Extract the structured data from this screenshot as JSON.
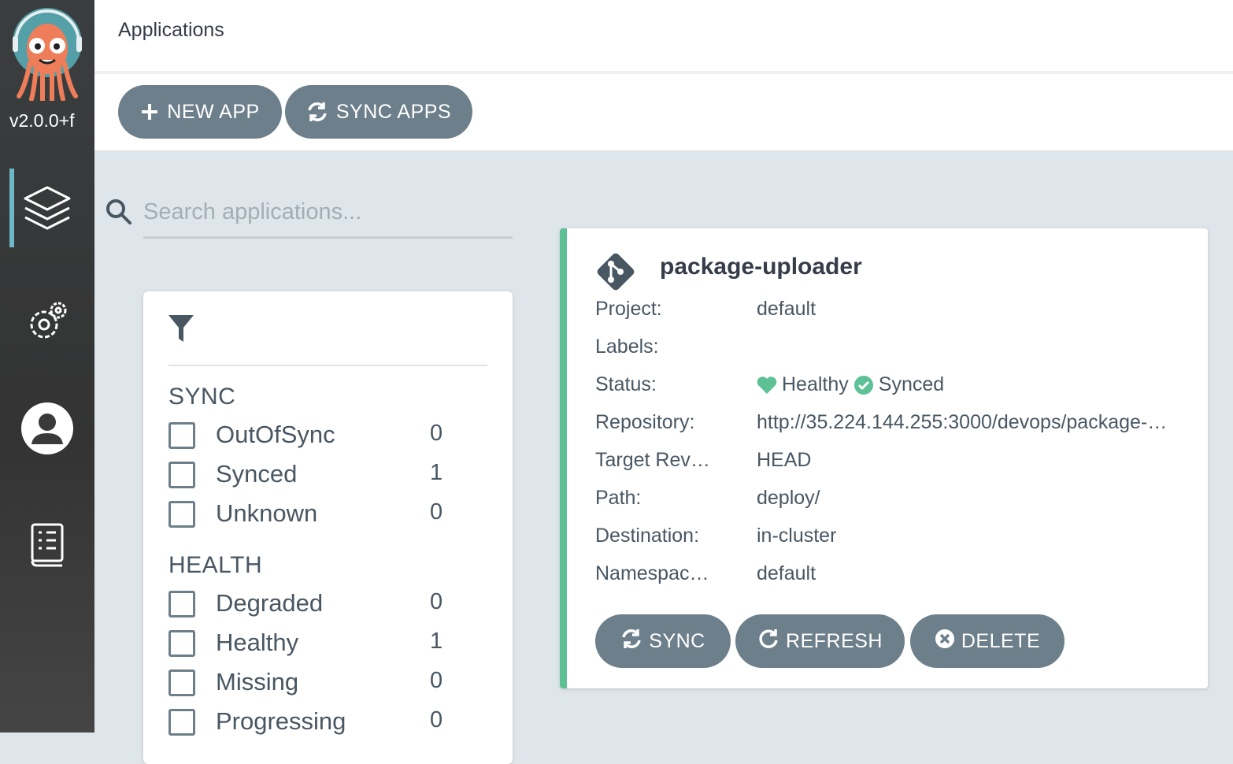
{
  "sidebar": {
    "logo_icon": "argo-octopus-logo",
    "version": "v2.0.0+f",
    "nav": [
      {
        "icon": "layers-icon",
        "active": true
      },
      {
        "icon": "gears-icon",
        "active": false
      },
      {
        "icon": "user-icon",
        "active": false
      },
      {
        "icon": "docs-icon",
        "active": false
      }
    ]
  },
  "header": {
    "title": "Applications"
  },
  "toolbar": {
    "new_app_label": "NEW APP",
    "new_app_icon": "plus-icon",
    "sync_apps_label": "SYNC APPS",
    "sync_apps_icon": "sync-icon"
  },
  "search": {
    "placeholder": "Search applications...",
    "value": ""
  },
  "filters": {
    "icon": "filter-icon",
    "sections": [
      {
        "title": "SYNC",
        "items": [
          {
            "label": "OutOfSync",
            "count": "0",
            "checked": false
          },
          {
            "label": "Synced",
            "count": "1",
            "checked": false
          },
          {
            "label": "Unknown",
            "count": "0",
            "checked": false
          }
        ]
      },
      {
        "title": "HEALTH",
        "items": [
          {
            "label": "Degraded",
            "count": "0",
            "checked": false
          },
          {
            "label": "Healthy",
            "count": "1",
            "checked": false
          },
          {
            "label": "Missing",
            "count": "0",
            "checked": false
          },
          {
            "label": "Progressing",
            "count": "0",
            "checked": false
          }
        ]
      }
    ]
  },
  "app": {
    "name": "package-uploader",
    "icon": "git-icon",
    "fields": {
      "project_label": "Project:",
      "project": "default",
      "labels_label": "Labels:",
      "labels": "",
      "status_label": "Status:",
      "health": "Healthy",
      "sync": "Synced",
      "repository_label": "Repository:",
      "repository": "http://35.224.144.255:3000/devops/package-…",
      "target_label": "Target Rev…",
      "target": "HEAD",
      "path_label": "Path:",
      "path": "deploy/",
      "destination_label": "Destination:",
      "destination": "in-cluster",
      "namespace_label": "Namespac…",
      "namespace": "default"
    },
    "actions": {
      "sync_label": "SYNC",
      "refresh_label": "REFRESH",
      "delete_label": "DELETE"
    }
  },
  "colors": {
    "sidebar_bg": "#333333",
    "accent_green": "#5ec196",
    "button_gray": "#6d7f8b",
    "active_nav": "#6db8c7"
  }
}
